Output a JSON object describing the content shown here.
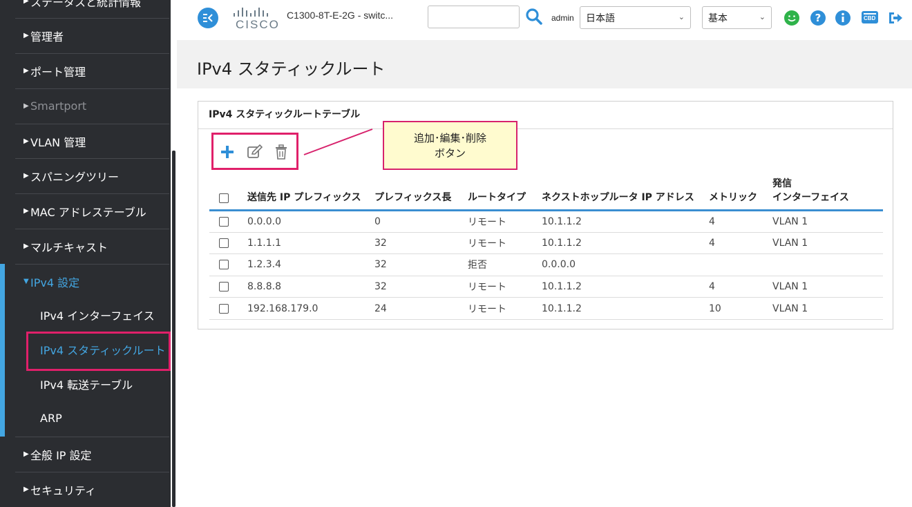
{
  "sidebar": {
    "items": [
      {
        "label": "ステータスと統計情報",
        "state": "normal"
      },
      {
        "label": "管理者",
        "state": "normal"
      },
      {
        "label": "ポート管理",
        "state": "normal"
      },
      {
        "label": "Smartport",
        "state": "disabled"
      },
      {
        "label": "VLAN 管理",
        "state": "normal"
      },
      {
        "label": "スパニングツリー",
        "state": "normal"
      },
      {
        "label": "MAC アドレステーブル",
        "state": "normal"
      },
      {
        "label": "マルチキャスト",
        "state": "normal"
      },
      {
        "label": "IPv4 設定",
        "state": "open"
      },
      {
        "label": "全般 IP 設定",
        "state": "normal"
      },
      {
        "label": "セキュリティ",
        "state": "normal"
      }
    ],
    "subitems": [
      {
        "label": "IPv4 インターフェイス"
      },
      {
        "label": "IPv4 スタティックルート",
        "active": true
      },
      {
        "label": "IPv4 転送テーブル"
      },
      {
        "label": "ARP"
      }
    ]
  },
  "header": {
    "logo_text": "CISCO",
    "device_name": "C1300-8T-E-2G - switc...",
    "search_value": "",
    "user": "admin",
    "language": "日本語",
    "mode": "基本",
    "cbd_label": "CBD"
  },
  "page": {
    "title": "IPv4 スタティックルート",
    "panel_title": "IPv4 スタティックルートテーブル",
    "callout_line1": "追加･編集･削除",
    "callout_line2": "ボタン"
  },
  "table": {
    "columns": {
      "dest": "送信先 IP プレフィックス",
      "len": "プレフィックス長",
      "type": "ルートタイプ",
      "hop": "ネクストホップルータ IP アドレス",
      "metric": "メトリック",
      "if_line1": "発信",
      "if_line2": "インターフェイス"
    },
    "rows": [
      {
        "dest": "0.0.0.0",
        "len": "0",
        "type": "リモート",
        "hop": "10.1.1.2",
        "metric": "4",
        "iface": "VLAN 1"
      },
      {
        "dest": "1.1.1.1",
        "len": "32",
        "type": "リモート",
        "hop": "10.1.1.2",
        "metric": "4",
        "iface": "VLAN 1"
      },
      {
        "dest": "1.2.3.4",
        "len": "32",
        "type": "拒否",
        "hop": "0.0.0.0",
        "metric": "",
        "iface": ""
      },
      {
        "dest": "8.8.8.8",
        "len": "32",
        "type": "リモート",
        "hop": "10.1.1.2",
        "metric": "4",
        "iface": "VLAN 1"
      },
      {
        "dest": "192.168.179.0",
        "len": "24",
        "type": "リモート",
        "hop": "10.1.1.2",
        "metric": "10",
        "iface": "VLAN 1"
      }
    ]
  },
  "colors": {
    "accent": "#43a6e2",
    "highlight": "#e0206a",
    "sidebar_bg": "#2b2d31",
    "status_green": "#2fb34a"
  }
}
